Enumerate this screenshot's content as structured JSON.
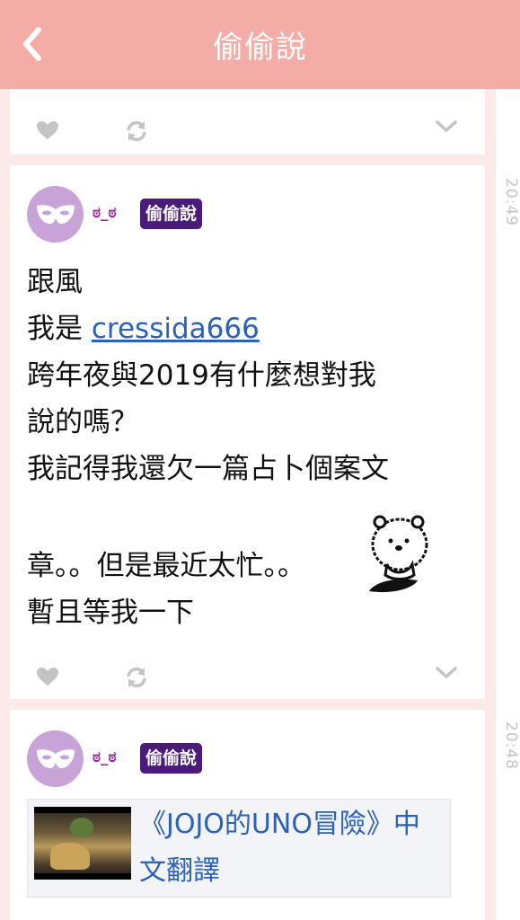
{
  "header": {
    "title": "偷偷說",
    "back_icon": "chevron-left-icon"
  },
  "colors": {
    "header_bg": "#f4aca7",
    "tag_bg": "#4b1b7a",
    "link": "#2b61b8",
    "avatar_bg": "#c7a3d8"
  },
  "posts": [
    {
      "time": "20:49",
      "username": "ಠ_ಠ",
      "tag": "偷偷說",
      "lines": [
        "跟風",
        "我是",
        "跨年夜與2019有什麼想對我",
        "說的嗎？",
        "我記得我還欠一篇占卜個案文",
        "",
        "章。。但是最近太忙。。",
        "暫且等我一下"
      ],
      "mention": "cressida666"
    },
    {
      "time": "20:48",
      "username": "ಠ_ಠ",
      "tag": "偷偷說",
      "link_title": "《JOJO的UNO冒險》中文翻譯"
    }
  ]
}
